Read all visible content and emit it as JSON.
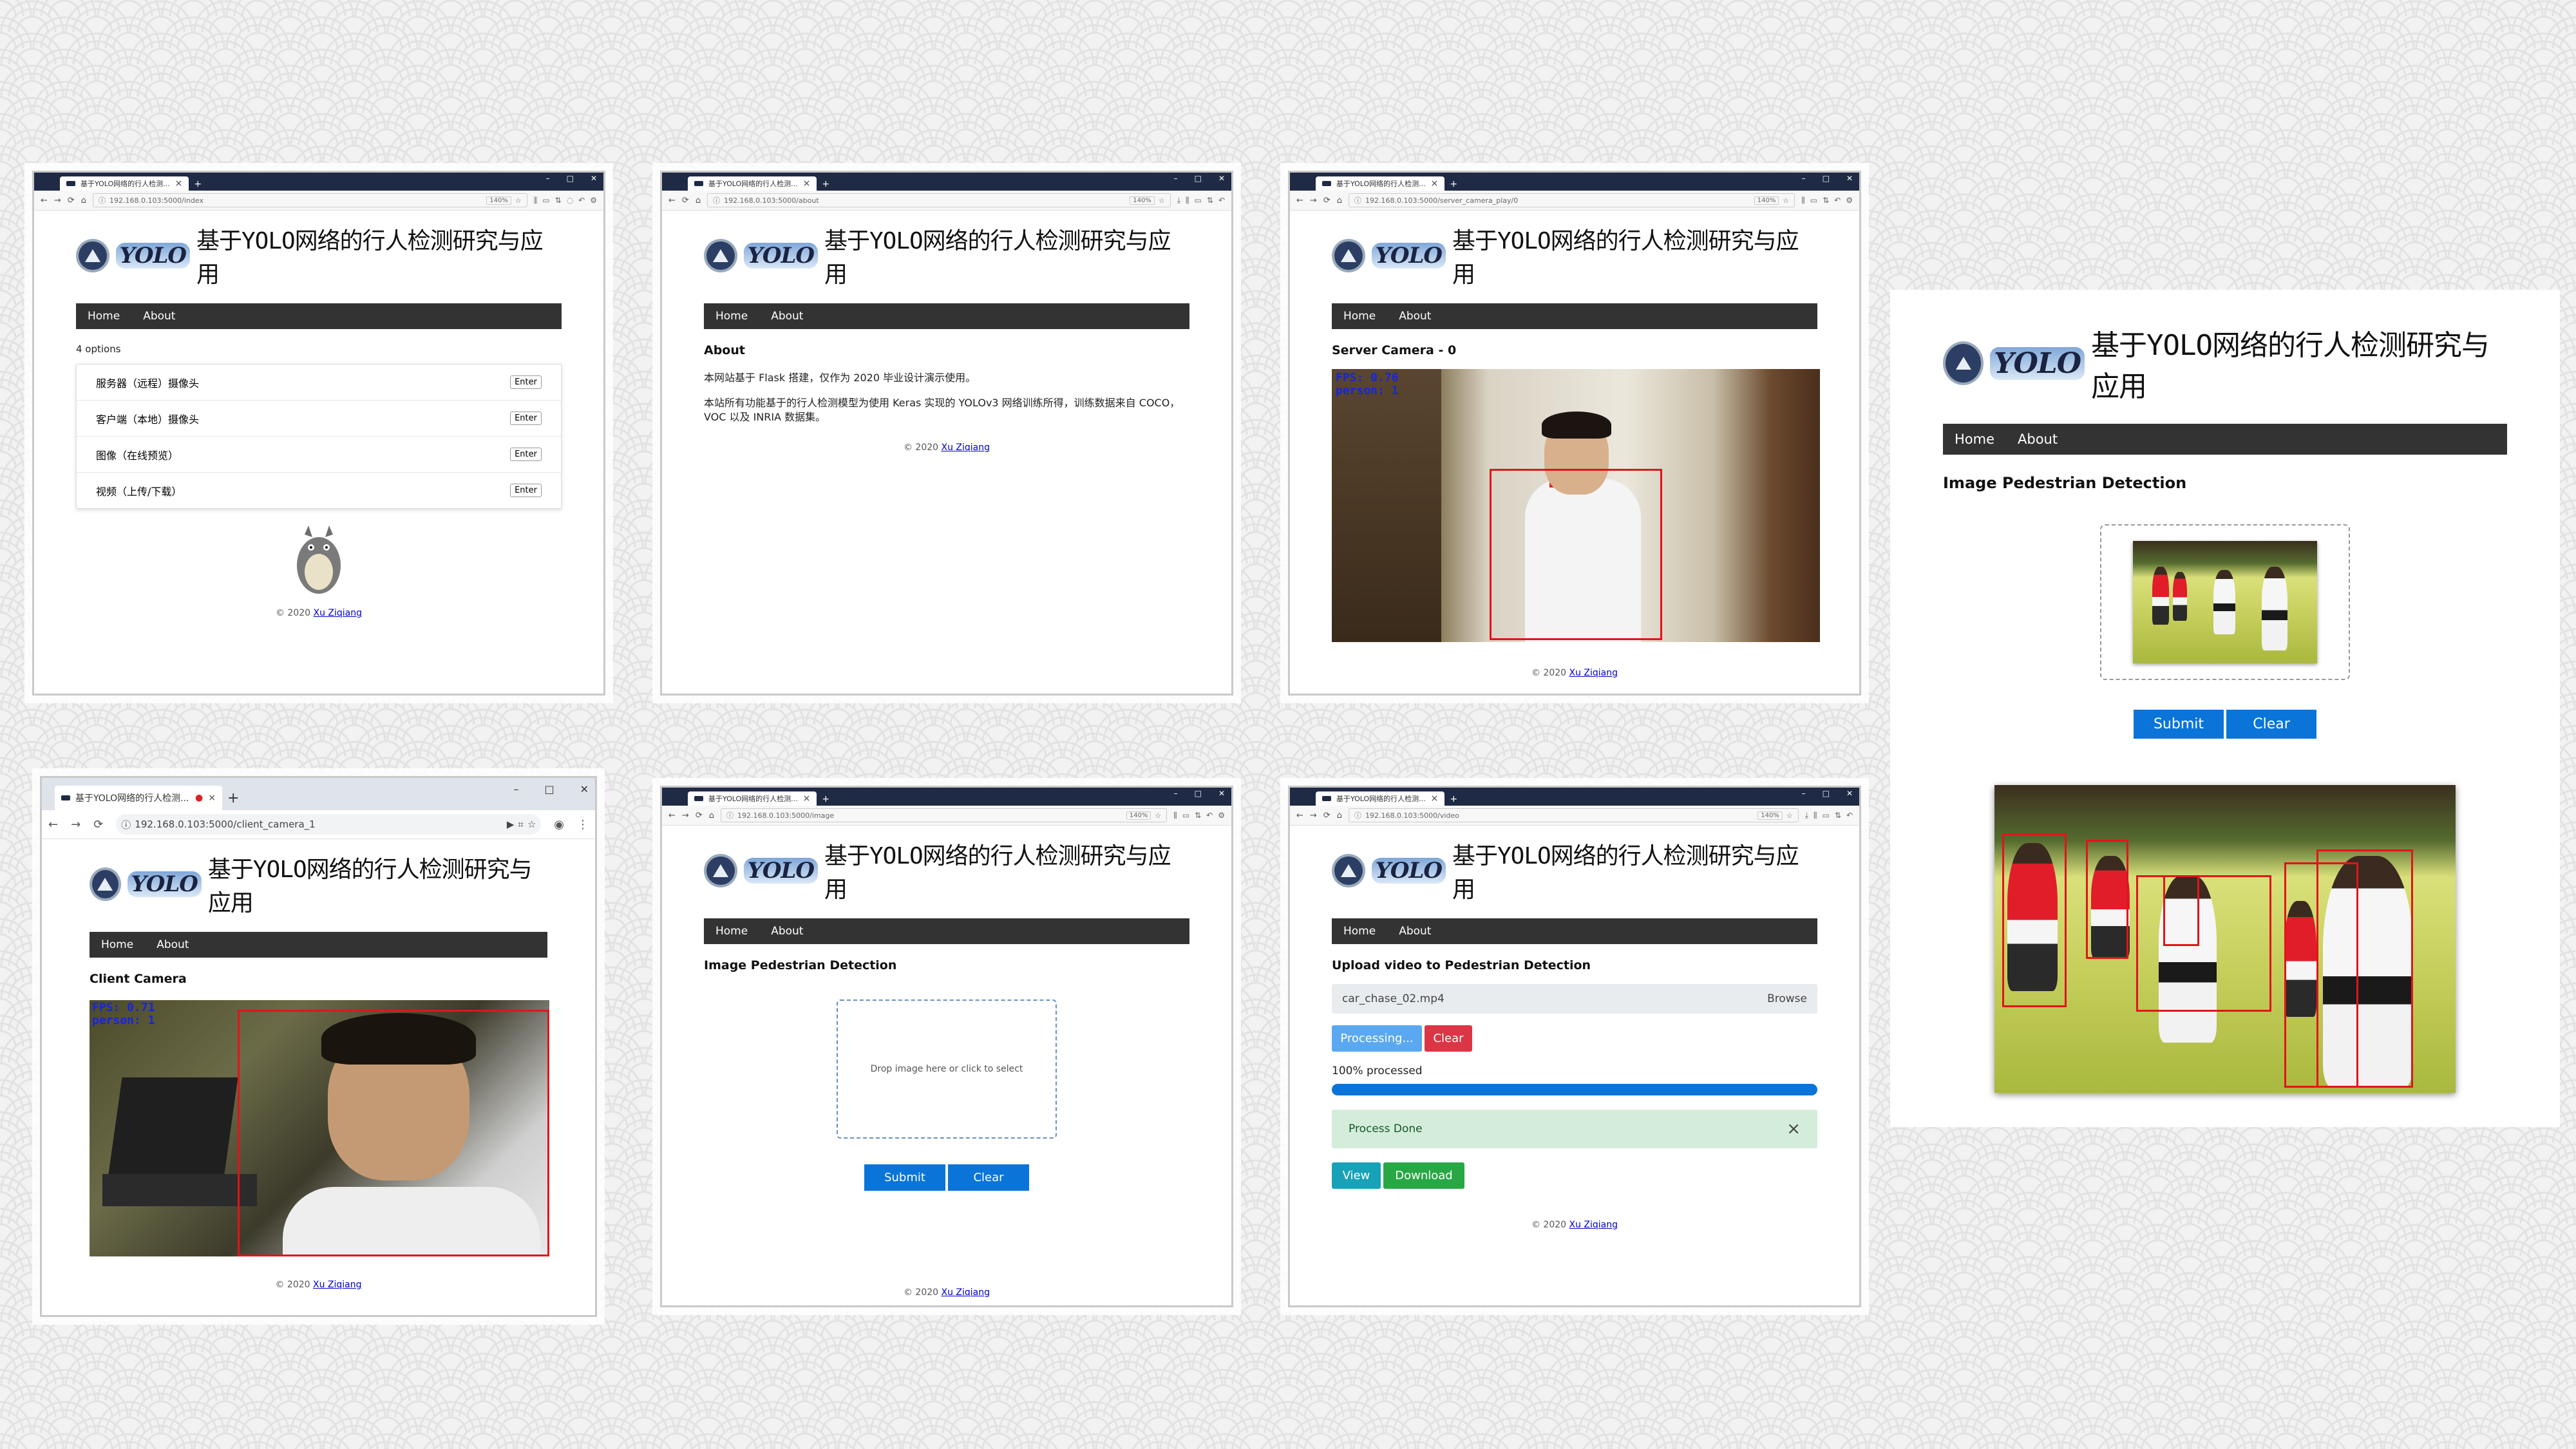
{
  "common": {
    "site_title": "基于YOLO网络的行人检测研究与应用",
    "logo_text": "YOLO",
    "nav_home": "Home",
    "nav_about": "About",
    "footer_prefix": "© 2020",
    "footer_author": "Xu Ziqiang",
    "tab_title": "基于YOLO网络的行人检测...",
    "win_minimize": "–",
    "win_maximize": "□",
    "win_close": "✕",
    "new_tab": "+",
    "tab_close": "×",
    "zoom": "140%"
  },
  "panel_index": {
    "url": "192.168.0.103:5000/index",
    "options_count": "4 options",
    "options": [
      {
        "label": "服务器（远程）摄像头",
        "button": "Enter"
      },
      {
        "label": "客户端（本地）摄像头",
        "button": "Enter"
      },
      {
        "label": "图像（在线预览）",
        "button": "Enter"
      },
      {
        "label": "视频（上传/下载）",
        "button": "Enter"
      }
    ]
  },
  "panel_about": {
    "url": "192.168.0.103:5000/about",
    "heading": "About",
    "para1": "本网站基于 Flask 搭建，仅作为 2020 毕业设计演示使用。",
    "para2": "本站所有功能基于的行人检测模型为使用 Keras 实现的 YOLOv3 网络训练所得，训练数据来自 COCO，VOC 以及 INRIA 数据集。"
  },
  "panel_server": {
    "url": "192.168.0.103:5000/server_camera_play/0",
    "heading": "Server Camera - 0",
    "fps_line1": "FPS: 0.76",
    "fps_line2": "person: 1"
  },
  "panel_client": {
    "url": "192.168.0.103:5000/client_camera_1",
    "heading": "Client Camera",
    "fps_line1": "FPS: 0.71",
    "fps_line2": "person: 1"
  },
  "panel_image": {
    "url": "192.168.0.103:5000/image",
    "heading": "Image Pedestrian Detection",
    "drop_text": "Drop image here or click to select",
    "submit": "Submit",
    "clear": "Clear"
  },
  "panel_video": {
    "url": "192.168.0.103:5000/video",
    "heading": "Upload video to Pedestrian Detection",
    "file_name": "car_chase_02.mp4",
    "browse": "Browse",
    "processing": "Processing...",
    "clear": "Clear",
    "progress_text": "100% processed",
    "progress_value": 1.0,
    "alert": "Process Done",
    "alert_close": "×",
    "view": "View",
    "download": "Download"
  },
  "panel_result": {
    "heading": "Image Pedestrian Detection",
    "submit": "Submit",
    "clear": "Clear"
  }
}
